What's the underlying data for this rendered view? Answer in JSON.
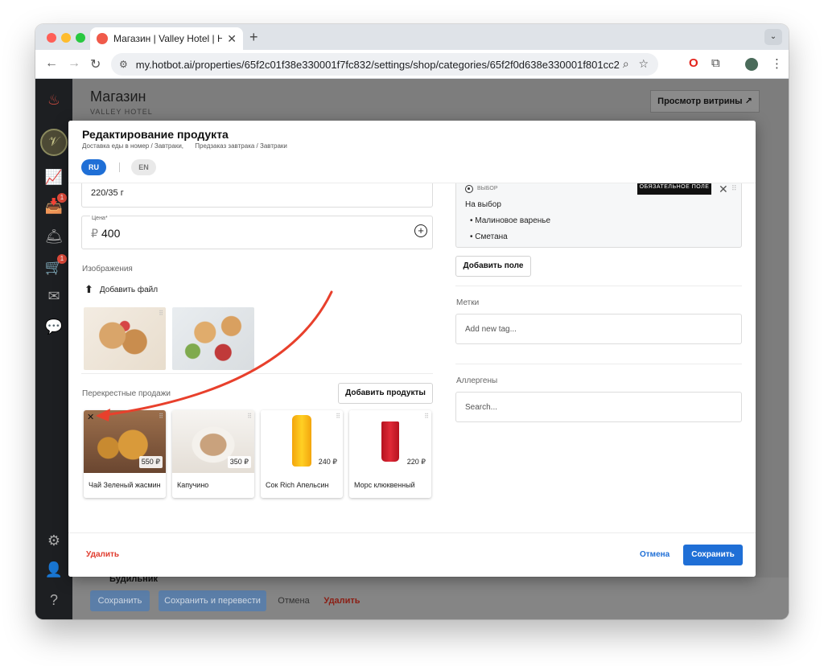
{
  "browser": {
    "tab_title": "Магазин | Valley Hotel | Hotbot",
    "url": "my.hotbot.ai/properties/65f2c01f38e330001f7fc832/settings/shop/categories/65f2f0d638e330001f801cc2",
    "traffic_colors": [
      "#ff5f57",
      "#febc2e",
      "#28c840"
    ]
  },
  "sidebar": {
    "badges": [
      "1",
      "1"
    ],
    "icons": [
      "flame-icon",
      "chart-icon",
      "inbox-icon",
      "bell-icon",
      "cart-icon",
      "mail-icon",
      "chat-icon",
      "settings-icon",
      "user-icon",
      "help-icon"
    ]
  },
  "background_page": {
    "title": "Магазин",
    "subtitle": "VALLEY HOTEL",
    "storefront_button": "Просмотр витрины",
    "peek_text": "Будильник",
    "save": "Сохранить",
    "save_translate": "Сохранить и перевести",
    "cancel": "Отмена",
    "delete": "Удалить"
  },
  "modal": {
    "title": "Редактирование продукта",
    "breadcrumbs": [
      "Доставка еды в номер / Завтраки,",
      "Предзаказ завтрака / Завтраки"
    ],
    "languages": [
      {
        "code": "RU",
        "active": true
      },
      {
        "code": "EN",
        "active": false
      }
    ],
    "weight_value": "220/35 г",
    "price_label": "Цена*",
    "price_currency": "₽",
    "price_value": "400",
    "images_label": "Изображения",
    "add_file": "Добавить файл",
    "cross_sales_label": "Перекрестные продажи",
    "add_products": "Добавить продукты",
    "cross_sales": [
      {
        "name": "Чай Зеленый жасмин",
        "price": "550 ₽"
      },
      {
        "name": "Капучино",
        "price": "350 ₽"
      },
      {
        "name": "Сок Rich Апельсин",
        "price": "240 ₽"
      },
      {
        "name": "Морс клюквенный",
        "price": "220 ₽"
      }
    ],
    "option": {
      "type_label": "ВЫБОР",
      "required_tag": "ОБЯЗАТЕЛЬНОЕ ПОЛЕ",
      "title": "На выбор",
      "items": [
        "• Малиновое варенье",
        "• Сметана"
      ]
    },
    "add_field": "Добавить поле",
    "tags_label": "Метки",
    "tags_placeholder": "Add new tag...",
    "allergens_label": "Аллергены",
    "allergens_placeholder": "Search...",
    "delete": "Удалить",
    "cancel": "Отмена",
    "save": "Сохранить"
  },
  "colors": {
    "primary": "#1f6fd6",
    "danger": "#e03b2d",
    "arrow": "#e8402c"
  }
}
